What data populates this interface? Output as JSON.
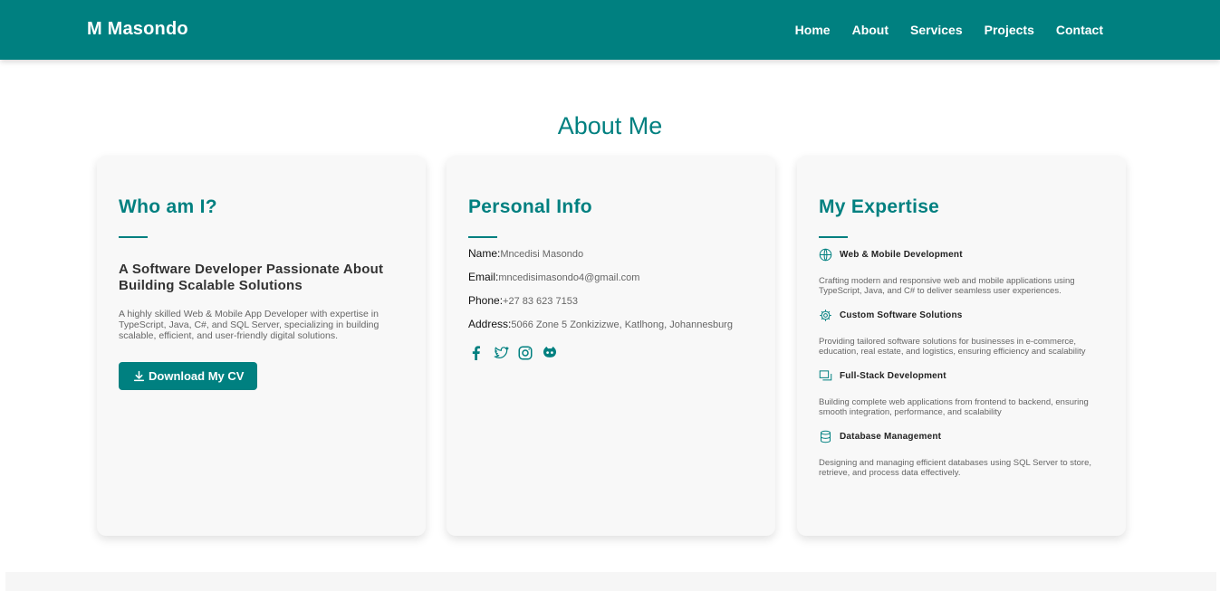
{
  "nav": {
    "brand": "M Masondo",
    "links": [
      "Home",
      "About",
      "Services",
      "Projects",
      "Contact"
    ]
  },
  "section_title": "About Me",
  "who": {
    "title": "Who am I?",
    "subhead": "A Software Developer Passionate About Building Scalable Solutions",
    "description": "A highly skilled Web & Mobile App Developer with expertise in TypeScript, Java, C#, and SQL Server, specializing in building scalable, efficient, and user-friendly digital solutions.",
    "cv_button": "Download My CV",
    "cv_icon": "download-icon"
  },
  "personal": {
    "title": "Personal Info",
    "rows": [
      {
        "label": "Name:",
        "value": "Mncedisi Masondo"
      },
      {
        "label": "Email:",
        "value": "mncedisimasondo4@gmail.com"
      },
      {
        "label": "Phone:",
        "value": "+27 83 623 7153"
      },
      {
        "label": "Address:",
        "value": "5066 Zone 5 Zonkizizwe, Katlhong, Johannesburg"
      }
    ],
    "socials": [
      "facebook-icon",
      "twitter-icon",
      "instagram-icon",
      "github-icon"
    ]
  },
  "expertise": {
    "title": "My Expertise",
    "items": [
      {
        "icon": "globe-icon",
        "title": "Web & Mobile Development",
        "desc": "Crafting modern and responsive web and mobile applications using TypeScript, Java, and C# to deliver seamless user experiences."
      },
      {
        "icon": "gear-icon",
        "title": "Custom Software Solutions",
        "desc": "Providing tailored software solutions for businesses in e-commerce, education, real estate, and logistics, ensuring efficiency and scalability"
      },
      {
        "icon": "windows-icon",
        "title": "Full-Stack Development",
        "desc": "Building complete web applications from frontend to backend, ensuring smooth integration, performance, and scalability"
      },
      {
        "icon": "database-icon",
        "title": "Database Management",
        "desc": "Designing and managing efficient databases using SQL Server to store, retrieve, and process data effectively."
      }
    ]
  },
  "colors": {
    "primary": "#008080",
    "card_bg": "#f8f8f8"
  }
}
